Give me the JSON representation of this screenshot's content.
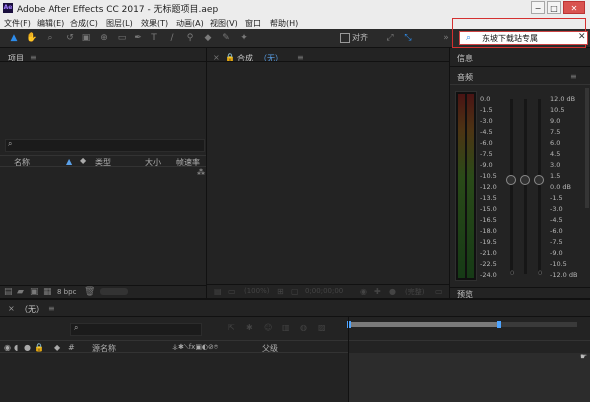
{
  "window": {
    "app_icon": "Ae",
    "title": "Adobe After Effects CC 2017 - 无标题项目.aep",
    "min": "−",
    "max": "□",
    "close": "✕"
  },
  "menu": [
    "文件(F)",
    "编辑(E)",
    "合成(C)",
    "图层(L)",
    "效果(T)",
    "动画(A)",
    "视图(V)",
    "窗口",
    "帮助(H)"
  ],
  "toolbar": {
    "snap_label": "对齐",
    "search_text": "东坡下载站专属",
    "search_clear": "✕"
  },
  "project_panel": {
    "title": "项目",
    "menu_icon": "≡",
    "search_glyph": "⌕",
    "columns": [
      "名称",
      "类型",
      "大小",
      "帧速率"
    ],
    "bpc": "8 bpc"
  },
  "comp_panel": {
    "title": "合成",
    "tab_label": "（无）",
    "footer": {
      "zoom": "(100%)",
      "timecode": "0;00;00;00",
      "view": "(完整)"
    }
  },
  "info_panel": {
    "title": "信息"
  },
  "audio_panel": {
    "title": "音频",
    "left_scale": [
      "0.0",
      "-1.5",
      "-3.0",
      "-4.5",
      "-6.0",
      "-7.5",
      "-9.0",
      "-10.5",
      "-12.0",
      "-13.5",
      "-15.0",
      "-16.5",
      "-18.0",
      "-19.5",
      "-21.0",
      "-22.5",
      "-24.0"
    ],
    "right_scale": [
      "12.0 dB",
      "10.5",
      "9.0",
      "7.5",
      "6.0",
      "4.5",
      "3.0",
      "1.5",
      "0.0 dB",
      "-1.5",
      "-3.0",
      "-4.5",
      "-6.0",
      "-7.5",
      "-9.0",
      "-10.5",
      "-12.0 dB"
    ],
    "slider_bottom_labels": [
      "0",
      "0"
    ]
  },
  "preview_panel": {
    "title": "预览"
  },
  "timeline": {
    "tab_label": "（无）",
    "close_glyph": "×",
    "columns": {
      "source": "源名称",
      "parent": "父级"
    }
  },
  "colors": {
    "accent_blue": "#2d8ceb",
    "highlight_red": "#d43030",
    "panel_bg": "#232323",
    "menu_bg": "#ececec"
  }
}
